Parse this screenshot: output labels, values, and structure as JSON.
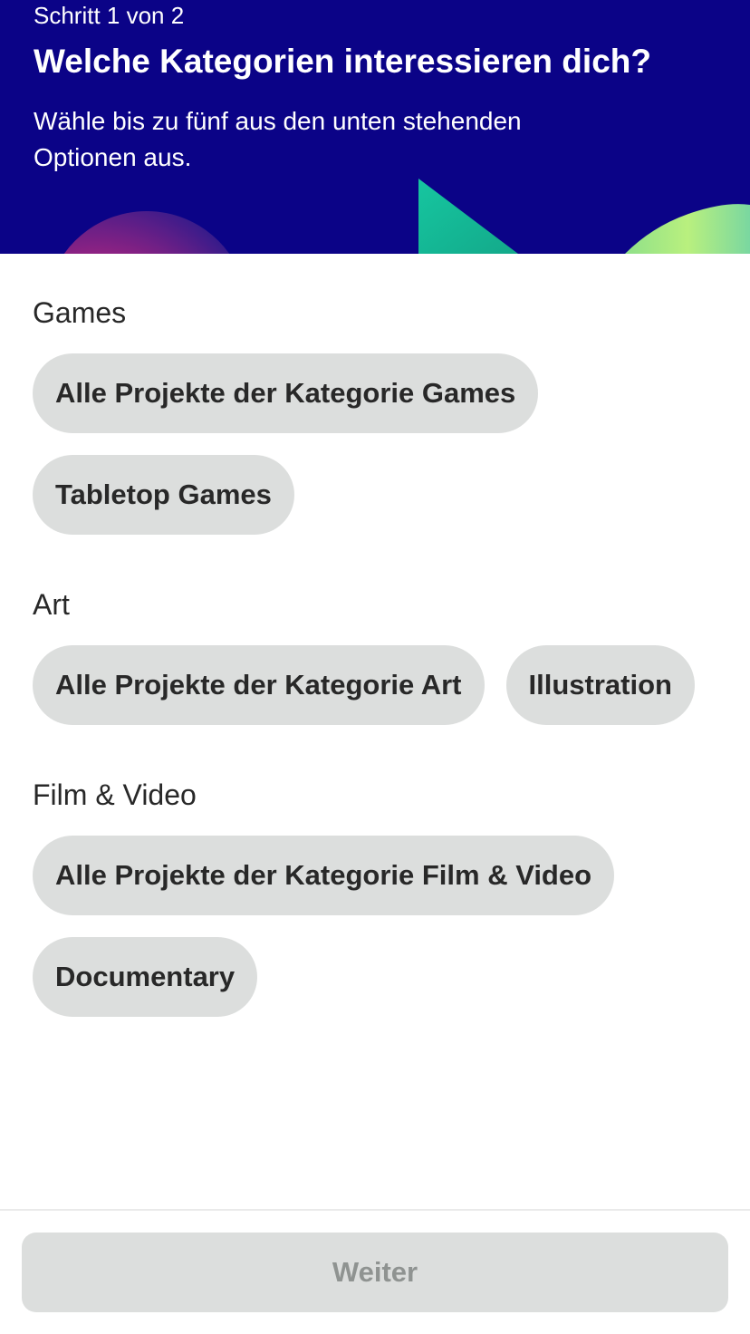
{
  "header": {
    "step": "Schritt 1 von 2",
    "title": "Welche Kategorien interessieren dich?",
    "subtitle": "Wähle bis zu fünf aus den unten stehenden Optionen aus.",
    "background_color": "#0b0387"
  },
  "sections": [
    {
      "title": "Games",
      "options": [
        "Alle Projekte der Kategorie Games",
        "Tabletop Games"
      ]
    },
    {
      "title": "Art",
      "options": [
        "Alle Projekte der Kategorie Art",
        "Illustration"
      ]
    },
    {
      "title": "Film & Video",
      "options": [
        "Alle Projekte der Kategorie Film & Video",
        "Documentary"
      ]
    }
  ],
  "footer": {
    "next_label": "Weiter",
    "next_enabled": false
  },
  "colors": {
    "pill_bg": "#dcdedd",
    "text": "#282828",
    "disabled_text": "#8f9391"
  }
}
